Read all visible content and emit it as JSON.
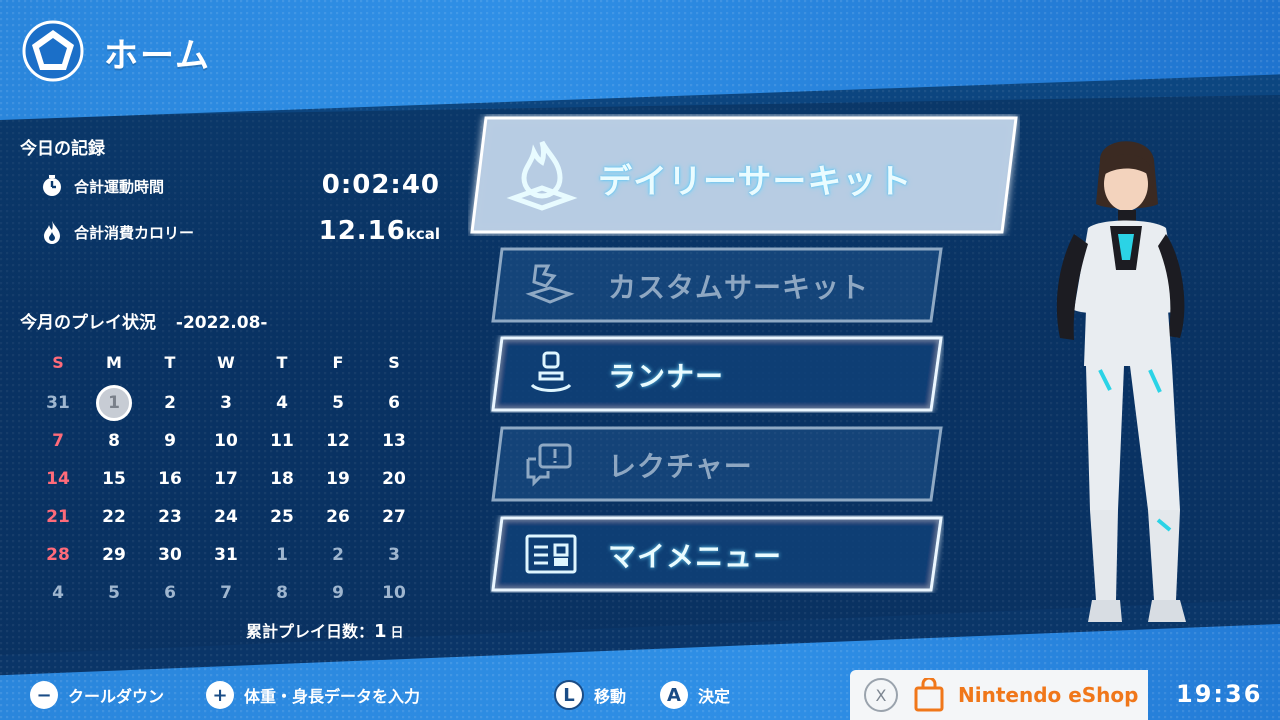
{
  "header": {
    "title": "ホーム",
    "icon": "pentagon-home-icon"
  },
  "today": {
    "title": "今日の記録",
    "exercise_time_label": "合計運動時間",
    "exercise_time_value": "0:02:40",
    "calories_label": "合計消費カロリー",
    "calories_value": "12.16",
    "calories_unit": "kcal"
  },
  "month": {
    "title": "今月のプレイ状況",
    "period": "-2022.08-",
    "weekdays": [
      "S",
      "M",
      "T",
      "W",
      "T",
      "F",
      "S"
    ],
    "weeks": [
      [
        "31",
        "1",
        "2",
        "3",
        "4",
        "5",
        "6"
      ],
      [
        "7",
        "8",
        "9",
        "10",
        "11",
        "12",
        "13"
      ],
      [
        "14",
        "15",
        "16",
        "17",
        "18",
        "19",
        "20"
      ],
      [
        "21",
        "22",
        "23",
        "24",
        "25",
        "26",
        "27"
      ],
      [
        "28",
        "29",
        "30",
        "31",
        "1",
        "2",
        "3"
      ],
      [
        "4",
        "5",
        "6",
        "7",
        "8",
        "9",
        "10"
      ]
    ],
    "total_days_label": "累計プレイ日数：",
    "total_days_value": "1",
    "total_days_unit": "日"
  },
  "menu": {
    "daily_circuit": "デイリーサーキット",
    "custom_circuit": "カスタムサーキット",
    "runner": "ランナー",
    "lecture": "レクチャー",
    "my_menu": "マイメニュー"
  },
  "footer": {
    "cooldown_key": "−",
    "cooldown_label": "クールダウン",
    "input_key": "+",
    "input_label": "体重・身長データを入力",
    "move_key": "L",
    "move_label": "移動",
    "confirm_key": "A",
    "confirm_label": "決定",
    "eshop_key": "X",
    "eshop_label": "Nintendo eShop",
    "clock": "19:36"
  },
  "colors": {
    "accent_cyan": "#7fe3ff",
    "sunday_red": "#ff6b7a",
    "eshop_orange": "#f0771a"
  }
}
